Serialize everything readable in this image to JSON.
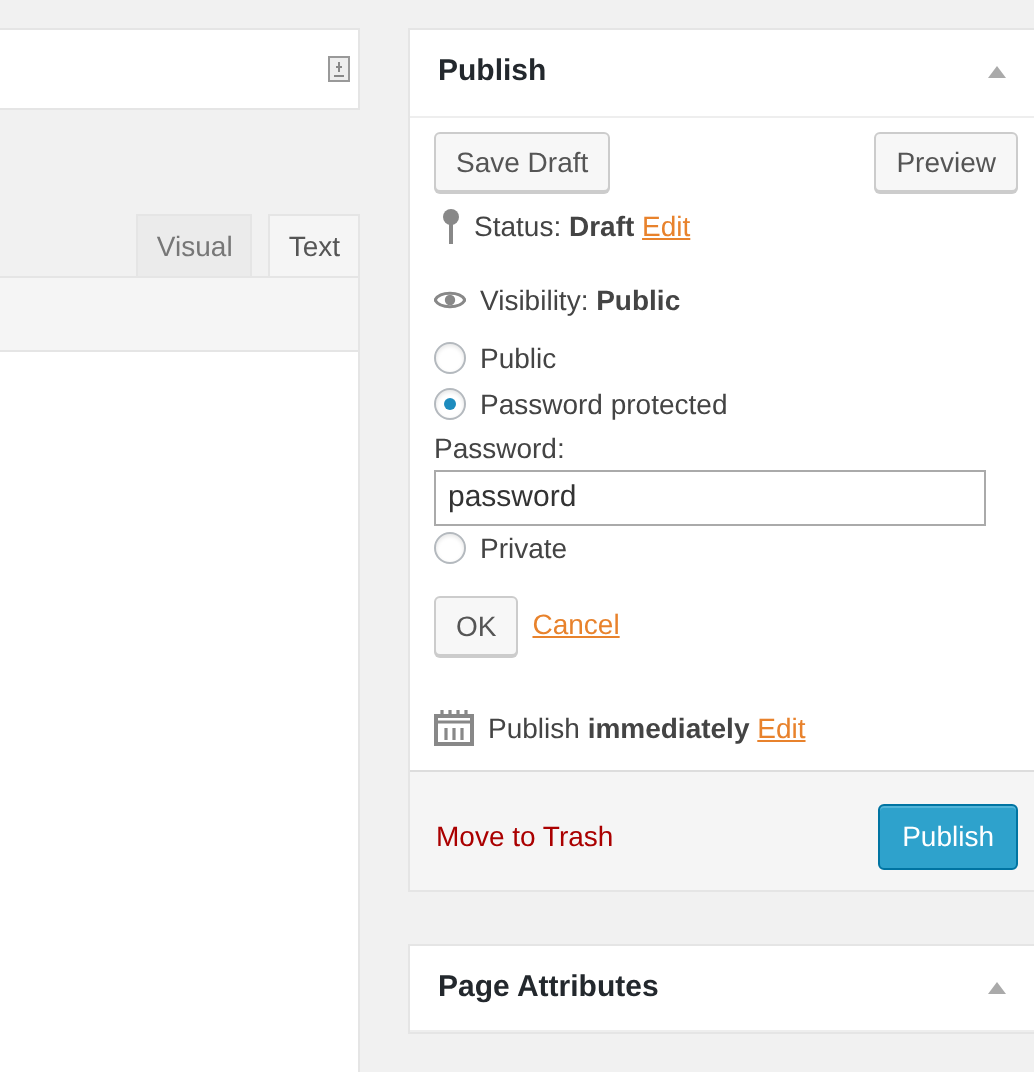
{
  "editor": {
    "tabs": [
      {
        "label": "Visual",
        "selected": false
      },
      {
        "label": "Text",
        "selected": true
      }
    ]
  },
  "publish": {
    "title": "Publish",
    "save_draft": "Save Draft",
    "preview": "Preview",
    "status": "Status: **Draft**",
    "status_edit": "Edit",
    "visibility": "Visibility: **Public**",
    "options": [
      {
        "kind": "radio",
        "label": "Public",
        "selected": false
      },
      {
        "kind": "radio",
        "label": "Password protected",
        "selected": true
      },
      {
        "kind": "field",
        "label": "Password:",
        "value": "password"
      },
      {
        "kind": "radio",
        "label": "Private",
        "selected": false
      }
    ],
    "ok": "OK",
    "cancel": "Cancel",
    "schedule": "Publish **immediately**",
    "schedule_edit": "Edit",
    "trash": "Move to Trash",
    "publish": "Publish"
  },
  "page_attributes": {
    "title": "Page Attributes"
  }
}
